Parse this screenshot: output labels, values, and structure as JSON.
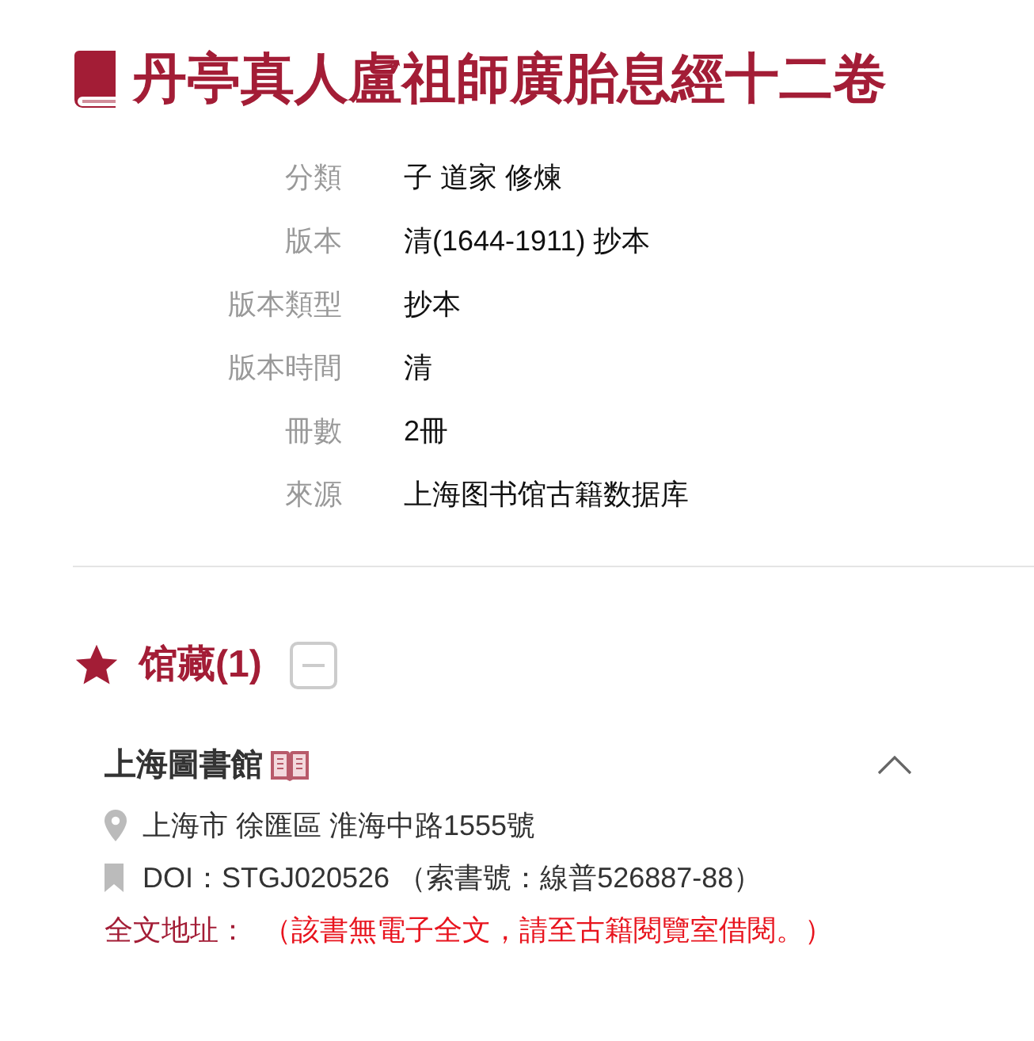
{
  "title": "丹亭真人盧祖師廣胎息經十二卷",
  "metadata": [
    {
      "label": "分類",
      "value": "子 道家 修煉"
    },
    {
      "label": "版本",
      "value": "清(1644-1911) 抄本"
    },
    {
      "label": "版本類型",
      "value": "抄本"
    },
    {
      "label": "版本時間",
      "value": "清"
    },
    {
      "label": "冊數",
      "value": "2冊"
    },
    {
      "label": "來源",
      "value": "上海图书馆古籍数据库"
    }
  ],
  "holdings": {
    "heading": "馆藏(1)",
    "expanded": true,
    "libraries": [
      {
        "name": "上海圖書館",
        "expanded": true,
        "address": "上海市 徐匯區 淮海中路1555號",
        "doi": "DOI：STGJ020526 （索書號：線普526887-88）",
        "fulltext_label": "全文地址：",
        "fulltext_value": "（該書無電子全文，請至古籍閱覽室借閱。）"
      }
    ]
  }
}
